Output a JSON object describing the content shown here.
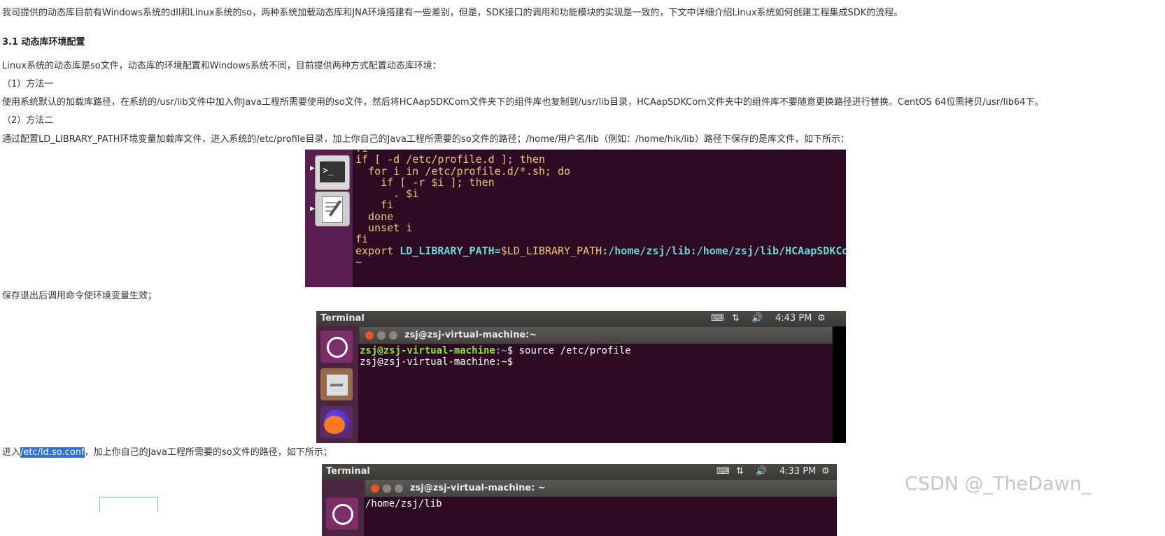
{
  "article": {
    "intro": "我司提供的动态库目前有Windows系统的dll和Linux系统的so，两种系统加载动态库和JNA环境搭建有一些差别，但是，SDK接口的调用和功能模块的实现是一致的，下文中详细介绍Linux系统如何创建工程集成SDK的流程。",
    "section_title": "3.1 动态库环境配置",
    "p1": "Linux系统的动态库是so文件，动态库的环境配置和Windows系统不同，目前提供两种方式配置动态库环境：",
    "m1_label": "（1）方法一",
    "m1_text": "使用系统默认的加载库路径，在系统的/usr/lib文件中加入你Java工程所需要使用的so文件，然后将HCAapSDKCom文件夹下的组件库也复制到/usr/lib目录，HCAapSDKCom文件夹中的组件库不要随意更换路径进行替换。CentOS 64位需拷贝/usr/lib64下。",
    "m2_label": "（2）方法二",
    "m2_text": "通过配置LD_LIBRARY_PATH环境变量加载库文件，进入系统的/etc/profile目录，加上你自己的Java工程所需要的so文件的路径；/home/用户名/lib（例如：/home/hik/lib）路径下保存的是库文件，如下所示：",
    "after_save": "保存退出后调用命令使环境变量生效；",
    "enter_prefix": "进入",
    "enter_selected": "/etc/ld.so.conf",
    "enter_suffix": "，加上你自己的Java工程所需要的so文件的路径，如下所示；",
    "watermark": "CSDN @_TheDawn_"
  },
  "shot1": {
    "lines": [
      "fi",
      "",
      "if [ -d /etc/profile.d ]; then",
      "  for i in /etc/profile.d/*.sh; do",
      "    if [ -r $i ]; then",
      "      . $i",
      "    fi",
      "  done",
      "  unset i",
      "fi"
    ],
    "export_kw": "export ",
    "export_var": "LD_LIBRARY_PATH=",
    "export_val": "$LD_LIBRARY_PATH",
    "export_path": ":/home/zsj/lib:/home/zsj/lib/HCAapSDKCom",
    "tilde": "~"
  },
  "shot2": {
    "app": "Terminal",
    "time": "4:43 PM",
    "window_title": "zsj@zsj-virtual-machine:~",
    "prompt": "zsj@zsj-virtual-machine",
    "path": ":~",
    "cmd1": "$ source /etc/profile",
    "line2": "zsj@zsj-virtual-machine:~$"
  },
  "shot3": {
    "app": "Terminal",
    "time": "4:33 PM",
    "window_title": "zsj@zsj-virtual-machine: ~",
    "line1": "/home/zsj/lib"
  },
  "colors": {
    "terminal_bg": "#2c0b23",
    "selection": "#2f6fd8",
    "prompt": "#8ae234"
  }
}
